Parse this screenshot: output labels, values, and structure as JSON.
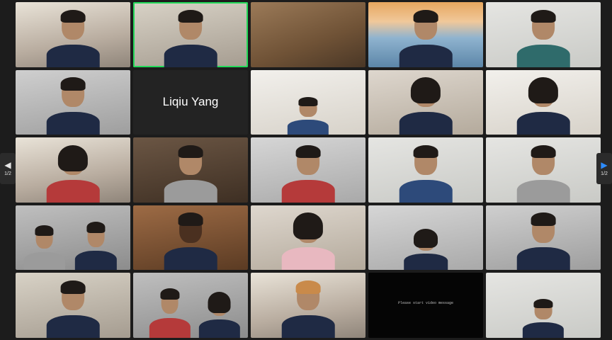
{
  "grid": {
    "named_tile": "Liqiu Yang",
    "blank_tile_message": "Please start video message"
  },
  "pagination": {
    "current_page": "1/2",
    "next_page": "1/2"
  },
  "colors": {
    "speaking_border": "#23d959",
    "next_arrow": "#2d8cff"
  }
}
